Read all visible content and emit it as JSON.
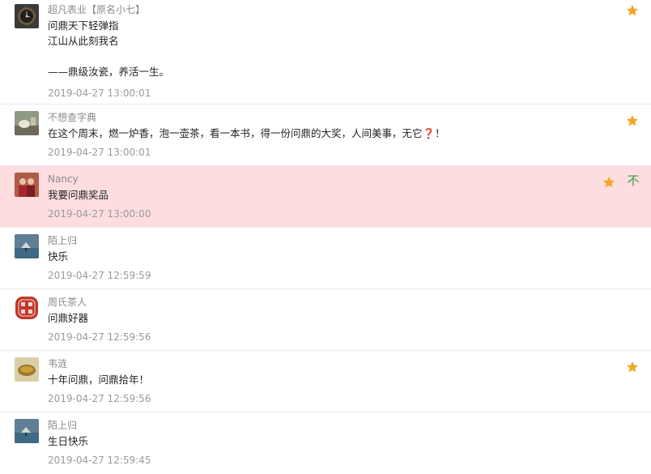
{
  "comments": [
    {
      "name": "超凡表业【原名小七】",
      "content": "问鼎天下轻弹指\n江山从此刻我名\n\n——鼎级汝瓷，养活一生。",
      "time": "2019-04-27 13:00:01",
      "starred": true,
      "avatar_icon": "watch-avatar-icon"
    },
    {
      "name": "不想查字典",
      "content": "在这个周末，燃一炉香，泡一壶茶，看一本书，得一份问鼎的大奖，人间美事，无它❓！",
      "time": "2019-04-27 13:00:01",
      "starred": true,
      "avatar_icon": "tea-avatar-icon"
    },
    {
      "name": "Nancy",
      "content": "我要问鼎奖品",
      "time": "2019-04-27 13:00:00",
      "starred": true,
      "highlight": true,
      "top_action": "不",
      "avatar_icon": "people-avatar-icon"
    },
    {
      "name": "陌上归",
      "content": "快乐",
      "time": "2019-04-27 12:59:59",
      "starred": false,
      "avatar_icon": "lake-avatar-icon"
    },
    {
      "name": "周氏茶人",
      "content": "问鼎好器",
      "time": "2019-04-27 12:59:56",
      "starred": false,
      "avatar_icon": "seal-avatar-icon"
    },
    {
      "name": "韦涟",
      "content": "十年问鼎，问鼎拾年！",
      "time": "2019-04-27 12:59:56",
      "starred": true,
      "avatar_icon": "teacup-avatar-icon"
    },
    {
      "name": "陌上归",
      "content": "生日快乐",
      "time": "2019-04-27 12:59:45",
      "starred": false,
      "avatar_icon": "lake-avatar-icon"
    }
  ],
  "colors": {
    "star": "#f5a623",
    "highlight_bg": "#fddde0",
    "top_action": "#3a9a3a"
  }
}
